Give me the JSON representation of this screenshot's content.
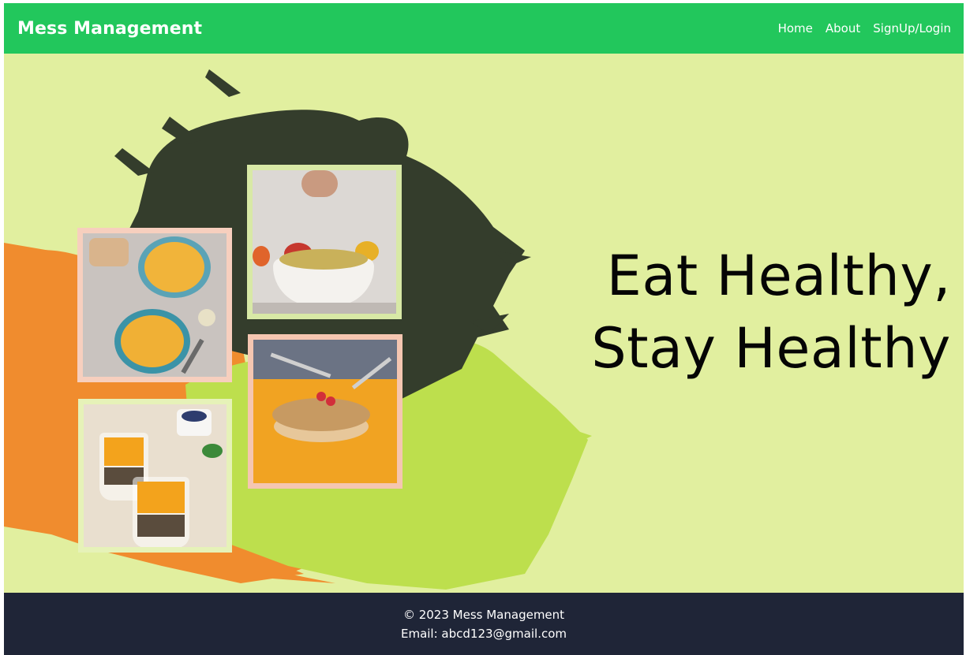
{
  "navbar": {
    "brand": "Mess Management",
    "links": [
      "Home",
      "About",
      "SignUp/Login"
    ]
  },
  "hero": {
    "tagline_line1": "Eat Healthy,",
    "tagline_line2": "Stay Healthy"
  },
  "footer": {
    "copyright": "© 2023 Mess Management",
    "email": "Email: abcd123@gmail.com"
  },
  "colors": {
    "navbar": "#22c75c",
    "hero_bg": "#e1ef9f",
    "splash_dark": "#343d2c",
    "splash_orange": "#f08c2e",
    "splash_lime": "#bddf4d",
    "footer_bg": "#1f2537"
  }
}
